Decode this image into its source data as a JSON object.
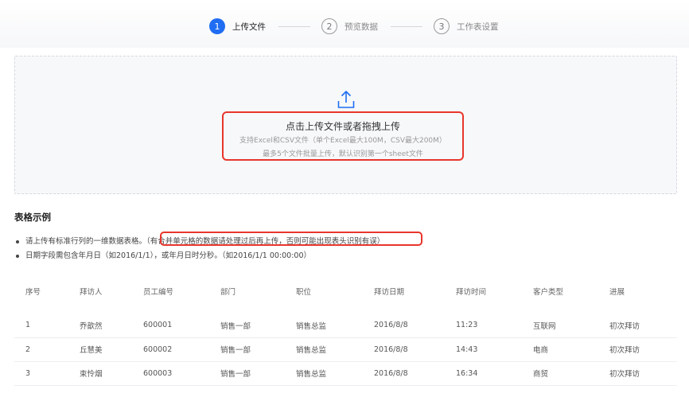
{
  "stepper": {
    "steps": [
      {
        "number": "1",
        "label": "上传文件",
        "state": "active"
      },
      {
        "number": "2",
        "label": "预览数据",
        "state": "inactive"
      },
      {
        "number": "3",
        "label": "工作表设置",
        "state": "inactive"
      }
    ]
  },
  "dropzone": {
    "icon": "upload-icon",
    "title": "点击上传文件或者拖拽上传",
    "subtitle": "支持Excel和CSV文件（单个Excel最大100M，CSV最大200M）",
    "note": "最多5个文件批量上传，默认识别第一个sheet文件"
  },
  "example": {
    "title": "表格示例",
    "rule1_main": "请上传有标准行列的一维数据表格。",
    "rule1_note": "（有合并单元格的数据请处理过后再上传，否则可能出现表头识别有误）",
    "rule2": "日期字段需包含年月日（如2016/1/1），或年月日时分秒。（如2016/1/1 00:00:00）"
  },
  "table": {
    "headers": [
      "序号",
      "拜访人",
      "员工编号",
      "部门",
      "职位",
      "拜访日期",
      "拜访时间",
      "客户类型",
      "进展"
    ],
    "rows": [
      [
        "1",
        "乔歆然",
        "600001",
        "销售一部",
        "销售总监",
        "2016/8/8",
        "11:23",
        "互联网",
        "初次拜访"
      ],
      [
        "2",
        "丘慧美",
        "600002",
        "销售一部",
        "销售总监",
        "2016/8/8",
        "14:43",
        "电商",
        "初次拜访"
      ],
      [
        "3",
        "束怜烟",
        "600003",
        "销售一部",
        "销售总监",
        "2016/8/8",
        "16:34",
        "商贸",
        "初次拜访"
      ]
    ]
  },
  "colors": {
    "accent": "#1f6df2",
    "highlight": "#e8362d"
  }
}
